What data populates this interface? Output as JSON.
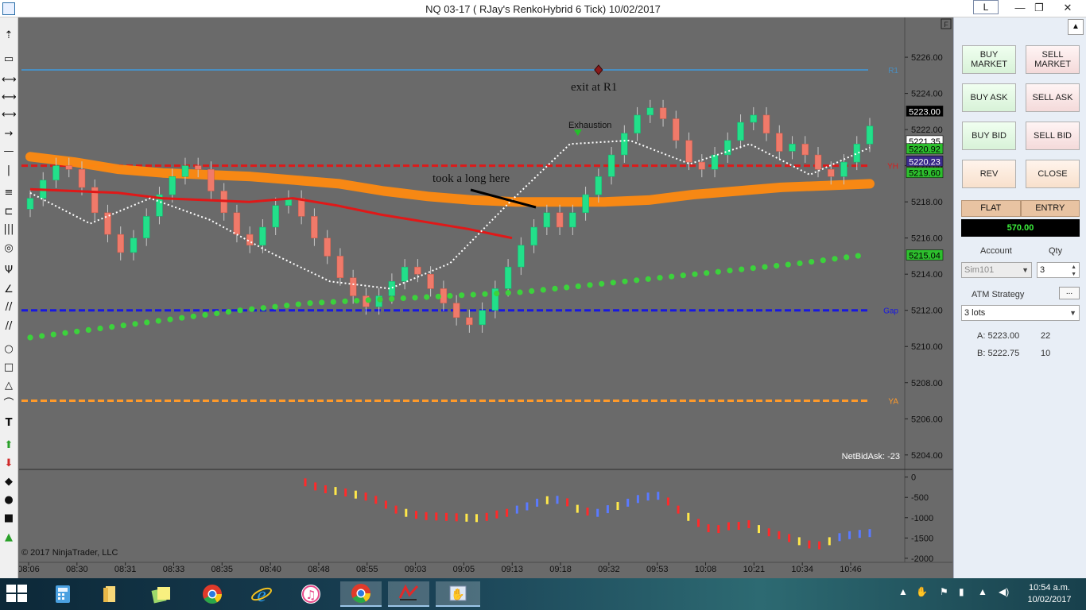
{
  "window": {
    "title": "NQ 03-17 ( RJay's RenkoHybrid  6 Tick)  10/02/2017",
    "layout_button": "L",
    "minimize": "—",
    "maximize": "❐",
    "close": "✕"
  },
  "chart_data": [
    {
      "type": "candlestick",
      "title": "NQ 03-17 ( RJay's RenkoHybrid  6 Tick)  10/02/2017",
      "y_axis": {
        "ticks": [
          5226,
          5224,
          5222,
          5220,
          5218,
          5216,
          5214,
          5212,
          5210,
          5208,
          5206,
          5204
        ],
        "tick_labels": [
          "5226.00",
          "5224.00",
          "5222.00",
          "5220.00",
          "5218.00",
          "5216.00",
          "5214.00",
          "5212.00",
          "5210.00",
          "5208.00",
          "5206.00",
          "5204.00"
        ],
        "range": [
          5203.2,
          5228.2
        ]
      },
      "x_axis": {
        "tick_labels": [
          "08:06",
          "08:30",
          "08:31",
          "08:33",
          "08:35",
          "08:40",
          "08:48",
          "08:55",
          "09:03",
          "09:05",
          "09:13",
          "09:18",
          "09:32",
          "09:53",
          "10:08",
          "10:21",
          "10:34",
          "10:46"
        ]
      },
      "closes": [
        5218.2,
        5219.2,
        5220.0,
        5219.8,
        5218.8,
        5217.4,
        5216.2,
        5215.2,
        5216.0,
        5217.2,
        5218.4,
        5219.4,
        5220.0,
        5219.8,
        5218.6,
        5217.4,
        5216.2,
        5215.6,
        5216.6,
        5217.8,
        5218.2,
        5217.2,
        5216.0,
        5215.0,
        5213.8,
        5212.8,
        5212.2,
        5212.8,
        5213.6,
        5214.4,
        5214.0,
        5213.2,
        5212.4,
        5211.6,
        5211.2,
        5212.0,
        5213.2,
        5214.4,
        5215.6,
        5216.6,
        5217.4,
        5216.6,
        5217.4,
        5218.4,
        5219.4,
        5220.6,
        5221.8,
        5222.8,
        5223.2,
        5222.6,
        5221.4,
        5220.2,
        5219.8,
        5220.6,
        5221.4,
        5222.4,
        5222.8,
        5221.8,
        5220.8,
        5221.2,
        5220.6,
        5219.8,
        5219.4,
        5220.2,
        5221.2,
        5222.2
      ],
      "series": [
        {
          "name": "",
          "kind": "band",
          "color": "#ff8a10",
          "values": [
            5220.5,
            5220.2,
            5219.8,
            5219.6,
            5219.5,
            5219.4,
            5219.2,
            5219.0,
            5218.6,
            5218.3,
            5218.1,
            5218.0,
            5218.0,
            5218.0,
            5218.1,
            5218.4,
            5218.6,
            5218.8,
            5218.9,
            5219.0
          ]
        },
        {
          "name": "",
          "kind": "dots",
          "color": "#3cd23c",
          "values": [
            5210.5,
            5211.0,
            5211.5,
            5212.0,
            5212.4,
            5212.6,
            5212.8,
            5213.0,
            5213.4,
            5213.8,
            5214.2,
            5214.6,
            5215.1
          ]
        },
        {
          "name": "",
          "kind": "line",
          "color": "#e01818",
          "values": [
            5218.7,
            5218.6,
            5218.5,
            5218.2,
            5218.1,
            5218.0,
            5218.2,
            5217.8,
            5217.3,
            5216.9,
            5216.5,
            5216.0
          ]
        },
        {
          "name": "",
          "kind": "dotted",
          "color": "#ffffff",
          "values": [
            5218.5,
            5216.8,
            5218.2,
            5217.0,
            5215.2,
            5213.6,
            5213.2,
            5214.6,
            5218.0,
            5221.2,
            5221.4,
            5220.1,
            5221.2,
            5219.5,
            5221.0
          ]
        }
      ],
      "levels": [
        {
          "label": "R1",
          "value": 5225.3,
          "color": "#4a8ec0",
          "style": "solid"
        },
        {
          "label": "YH",
          "value": 5220.0,
          "color": "#dd1a1a",
          "style": "dashed"
        },
        {
          "label": "Gap",
          "value": 5212.0,
          "color": "#1818e0",
          "style": "dashed"
        },
        {
          "label": "YA",
          "value": 5207.0,
          "color": "#ff9a2a",
          "style": "dashed"
        }
      ],
      "price_tags": [
        {
          "value": 5223.0,
          "label": "5223.00",
          "bg": "#000000",
          "fg": "#ffffff"
        },
        {
          "value": 5221.35,
          "label": "5221.35",
          "bg": "#ffffff",
          "fg": "#000000"
        },
        {
          "value": 5220.92,
          "label": "5220.92",
          "bg": "#2dbf2d",
          "fg": "#000000"
        },
        {
          "value": 5220.23,
          "label": "5220.23",
          "bg": "#3a2a8a",
          "fg": "#ffffff"
        },
        {
          "value": 5219.6,
          "label": "5219.60",
          "bg": "#2dbf2d",
          "fg": "#000000"
        },
        {
          "value": 5215.04,
          "label": "5215.04",
          "bg": "#2dbf2d",
          "fg": "#000000"
        }
      ],
      "annotations": [
        "exit at R1",
        "Exhaustion",
        "took a long here"
      ],
      "netbidask": "NetBidAsk: -23",
      "copyright": "© 2017 NinjaTrader, LLC",
      "corner_box": "F"
    },
    {
      "type": "bar",
      "subpanel": "NetBidAsk",
      "y_axis": {
        "ticks": [
          0,
          -500,
          -1000,
          -1500,
          -2000
        ],
        "tick_labels": [
          "0",
          "-500",
          "-1000",
          "-1500",
          "-2000"
        ],
        "range": [
          -2100,
          150
        ]
      },
      "values": [
        -150,
        -250,
        -320,
        -360,
        -400,
        -450,
        -500,
        -580,
        -700,
        -820,
        -900,
        -950,
        -980,
        -990,
        -1000,
        -1010,
        -1020,
        -1030,
        -1000,
        -940,
        -900,
        -820,
        -740,
        -650,
        -590,
        -580,
        -640,
        -800,
        -870,
        -900,
        -810,
        -730,
        -650,
        -560,
        -500,
        -480,
        -620,
        -820,
        -1000,
        -1150,
        -1280,
        -1300,
        -1230,
        -1220,
        -1180,
        -1300,
        -1380,
        -1450,
        -1520,
        -1600,
        -1680,
        -1700,
        -1600,
        -1500,
        -1450,
        -1420,
        -1400
      ],
      "colors": [
        "#ff2a2a",
        "#ffe84a",
        "#5a7aff"
      ]
    }
  ],
  "panel": {
    "collapse_icon": "▲",
    "buttons": {
      "buy_market": "BUY MARKET",
      "sell_market": "SELL MARKET",
      "buy_ask": "BUY ASK",
      "sell_ask": "SELL ASK",
      "buy_bid": "BUY BID",
      "sell_bid": "SELL BID",
      "rev": "REV",
      "close": "CLOSE"
    },
    "flat": "FLAT",
    "entry": "ENTRY",
    "pnl": "570.00",
    "account_label": "Account",
    "qty_label": "Qty",
    "account_value": "Sim101",
    "qty_value": "3",
    "atm_label": "ATM Strategy",
    "atm_button": "...",
    "atm_value": "3 lots",
    "ask_label": "A: 5223.00",
    "ask_size": "22",
    "bid_label": "B: 5222.75",
    "bid_size": "10"
  },
  "taskbar": {
    "time": "10:54 a.m.",
    "date": "10/02/2017",
    "icons": [
      "windows-start-icon",
      "calculator-icon",
      "file-explorer-icon",
      "sticky-notes-icon",
      "chrome-icon",
      "internet-explorer-icon",
      "itunes-icon",
      "chrome-icon",
      "ninjatrader-icon",
      "hand-tool-icon"
    ]
  }
}
